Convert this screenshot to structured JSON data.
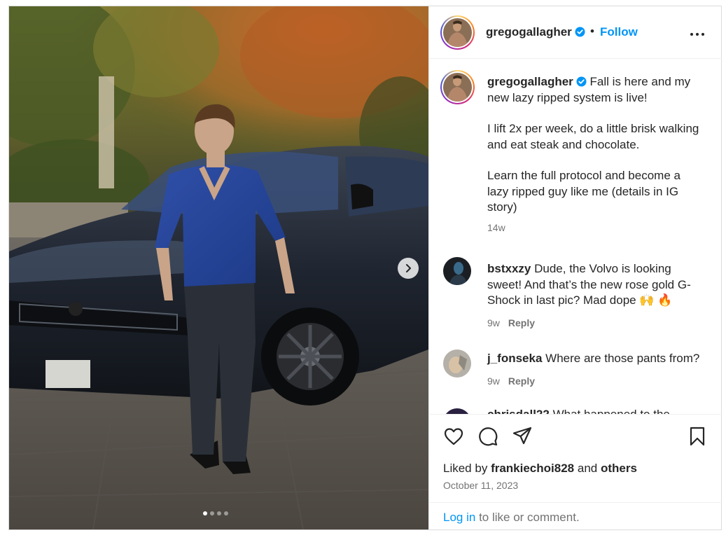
{
  "post": {
    "username": "gregogallagher",
    "verified": true,
    "follow_label": "Follow",
    "separator": "•",
    "more_icon": "more-horizontal-icon",
    "media": {
      "carousel_count": 4,
      "active_index": 0,
      "next_icon": "chevron-right-icon"
    },
    "caption": {
      "username": "gregogallagher",
      "lines": [
        "Fall is here and my new lazy ripped system is live!",
        "I lift 2x per week, do a little brisk walking and eat steak and chocolate.",
        "Learn the full protocol and become a lazy ripped guy like me (details in IG story)"
      ],
      "time": "14w"
    },
    "comments": [
      {
        "username": "bstxxzy",
        "text": "Dude, the Volvo is looking sweet! And that’s the new rose gold G-Shock in last pic? Mad dope 🙌 🔥",
        "time": "9w",
        "reply_label": "Reply"
      },
      {
        "username": "j_fonseka",
        "text": "Where are those pants from?",
        "time": "9w",
        "reply_label": "Reply"
      },
      {
        "username": "chrisdall22",
        "text": "What happened to the heads",
        "time": "",
        "reply_label": ""
      }
    ],
    "actions": {
      "like_icon": "heart-icon",
      "comment_icon": "comment-icon",
      "share_icon": "send-icon",
      "save_icon": "bookmark-icon"
    },
    "likes": {
      "prefix": "Liked by",
      "user": "frankiechoi828",
      "joiner": "and",
      "others": "others"
    },
    "date": "October 11, 2023",
    "login": {
      "link": "Log in",
      "rest": "to like or comment."
    },
    "colors": {
      "link_blue": "#0095f6",
      "text": "#262626",
      "secondary": "#737373",
      "border": "#dbdbdb"
    }
  }
}
